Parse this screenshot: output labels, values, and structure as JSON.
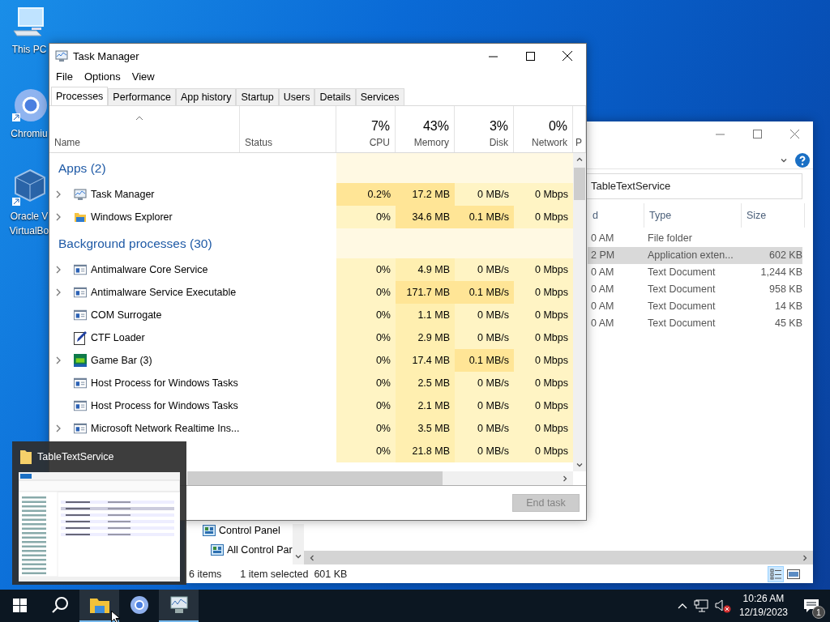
{
  "desktop": {
    "icons": [
      {
        "kind": "pc",
        "lines": [
          "This PC"
        ]
      },
      {
        "kind": "chromium",
        "lines": [
          "Chromiu"
        ]
      },
      {
        "kind": "virtualbox",
        "lines": [
          "Oracle V",
          "VirtualBo"
        ]
      }
    ]
  },
  "explorer": {
    "address": "TableTextService",
    "columns": [
      "d",
      "Type",
      "Size"
    ],
    "rows": [
      {
        "date": "0 AM",
        "type": "File folder",
        "selected": false
      },
      {
        "date": "2 PM",
        "type": "Application exten...",
        "size": "602 KB",
        "selected": true
      },
      {
        "date": "0 AM",
        "type": "Text Document",
        "size": "1,244 KB",
        "selected": false
      },
      {
        "date": "0 AM",
        "type": "Text Document",
        "size": "958 KB",
        "selected": false
      },
      {
        "date": "0 AM",
        "type": "Text Document",
        "size": "14 KB",
        "selected": false
      },
      {
        "date": "0 AM",
        "type": "Text Document",
        "size": "45 KB",
        "selected": false
      }
    ],
    "nav": [
      {
        "label": "Control Panel",
        "indent": false
      },
      {
        "label": "All Control Par",
        "indent": true
      }
    ],
    "status": {
      "items": "6 items",
      "selection": "1 item selected",
      "size": "601 KB"
    },
    "views": [
      {
        "kind": "details",
        "selected": true
      },
      {
        "kind": "large",
        "selected": false
      }
    ]
  },
  "task_manager": {
    "title": "Task Manager",
    "menu": [
      "File",
      "Options",
      "View"
    ],
    "tabs": [
      {
        "label": "Processes",
        "selected": true
      },
      {
        "label": "Performance",
        "selected": false
      },
      {
        "label": "App history",
        "selected": false
      },
      {
        "label": "Startup",
        "selected": false
      },
      {
        "label": "Users",
        "selected": false
      },
      {
        "label": "Details",
        "selected": false
      },
      {
        "label": "Services",
        "selected": false
      }
    ],
    "columns": [
      {
        "label": "Name"
      },
      {
        "label": "Status"
      },
      {
        "label": "CPU",
        "total": "7%"
      },
      {
        "label": "Memory",
        "total": "43%"
      },
      {
        "label": "Disk",
        "total": "3%"
      },
      {
        "label": "Network",
        "total": "0%"
      },
      {
        "label": "P"
      }
    ],
    "groups": [
      {
        "title": "Apps (2)",
        "rows": [
          {
            "name": "Task Manager",
            "kind": "monitor",
            "expandable": true,
            "cells": [
              {
                "text": "0.2%",
                "hot": true
              },
              {
                "text": "17.2 MB",
                "hot": true
              },
              {
                "text": "0 MB/s",
                "hot": false
              },
              {
                "text": "0 Mbps",
                "hot": false
              }
            ]
          },
          {
            "name": "Windows Explorer",
            "kind": "folder",
            "expandable": true,
            "cells": [
              {
                "text": "0%",
                "hot": false
              },
              {
                "text": "34.6 MB",
                "hot": true
              },
              {
                "text": "0.1 MB/s",
                "hot": true
              },
              {
                "text": "0 Mbps",
                "hot": false
              }
            ]
          }
        ]
      },
      {
        "title": "Background processes (30)",
        "rows": [
          {
            "name": "Antimalware Core Service",
            "kind": "service",
            "expandable": true,
            "cells": [
              {
                "text": "0%",
                "hot": false
              },
              {
                "text": "4.9 MB",
                "hot": false
              },
              {
                "text": "0 MB/s",
                "hot": false
              },
              {
                "text": "0 Mbps",
                "hot": false
              }
            ]
          },
          {
            "name": "Antimalware Service Executable",
            "kind": "service",
            "expandable": true,
            "cells": [
              {
                "text": "0%",
                "hot": false
              },
              {
                "text": "171.7 MB",
                "hot": true
              },
              {
                "text": "0.1 MB/s",
                "hot": true
              },
              {
                "text": "0 Mbps",
                "hot": false
              }
            ]
          },
          {
            "name": "COM Surrogate",
            "kind": "service",
            "expandable": false,
            "cells": [
              {
                "text": "0%",
                "hot": false
              },
              {
                "text": "1.1 MB",
                "hot": false
              },
              {
                "text": "0 MB/s",
                "hot": false
              },
              {
                "text": "0 Mbps",
                "hot": false
              }
            ]
          },
          {
            "name": "CTF Loader",
            "kind": "pen",
            "expandable": false,
            "cells": [
              {
                "text": "0%",
                "hot": false
              },
              {
                "text": "2.9 MB",
                "hot": false
              },
              {
                "text": "0 MB/s",
                "hot": false
              },
              {
                "text": "0 Mbps",
                "hot": false
              }
            ]
          },
          {
            "name": "Game Bar (3)",
            "kind": "gamebar",
            "expandable": true,
            "cells": [
              {
                "text": "0%",
                "hot": false
              },
              {
                "text": "17.4 MB",
                "hot": false
              },
              {
                "text": "0.1 MB/s",
                "hot": true
              },
              {
                "text": "0 Mbps",
                "hot": false
              }
            ]
          },
          {
            "name": "Host Process for Windows Tasks",
            "kind": "service",
            "expandable": false,
            "cells": [
              {
                "text": "0%",
                "hot": false
              },
              {
                "text": "2.5 MB",
                "hot": false
              },
              {
                "text": "0 MB/s",
                "hot": false
              },
              {
                "text": "0 Mbps",
                "hot": false
              }
            ]
          },
          {
            "name": "Host Process for Windows Tasks",
            "kind": "service",
            "expandable": false,
            "cells": [
              {
                "text": "0%",
                "hot": false
              },
              {
                "text": "2.1 MB",
                "hot": false
              },
              {
                "text": "0 MB/s",
                "hot": false
              },
              {
                "text": "0 Mbps",
                "hot": false
              }
            ]
          },
          {
            "name": "Microsoft Network Realtime Ins...",
            "kind": "service",
            "expandable": true,
            "cells": [
              {
                "text": "0%",
                "hot": false
              },
              {
                "text": "3.5 MB",
                "hot": false
              },
              {
                "text": "0 MB/s",
                "hot": false
              },
              {
                "text": "0 Mbps",
                "hot": false
              }
            ]
          },
          {
            "cells": [
              {
                "text": "0%",
                "hot": false
              },
              {
                "text": "21.8 MB",
                "hot": false
              },
              {
                "text": "0 MB/s",
                "hot": false
              },
              {
                "text": "0 Mbps",
                "hot": false
              }
            ]
          }
        ]
      }
    ],
    "end_task": {
      "label": "End task",
      "disabled": true
    }
  },
  "preview": {
    "title": "TableTextService"
  },
  "taskbar": {
    "items": [
      {
        "kind": "start",
        "open": false,
        "hovered": false
      },
      {
        "kind": "search",
        "open": false,
        "hovered": false
      },
      {
        "kind": "explorer",
        "open": true,
        "hovered": true
      },
      {
        "kind": "chromium",
        "open": false,
        "hovered": false
      },
      {
        "kind": "taskmanager",
        "open": true,
        "hovered": true
      }
    ],
    "tray": {
      "time": "10:26 AM",
      "date": "12/19/2023",
      "notifications": "1"
    }
  }
}
